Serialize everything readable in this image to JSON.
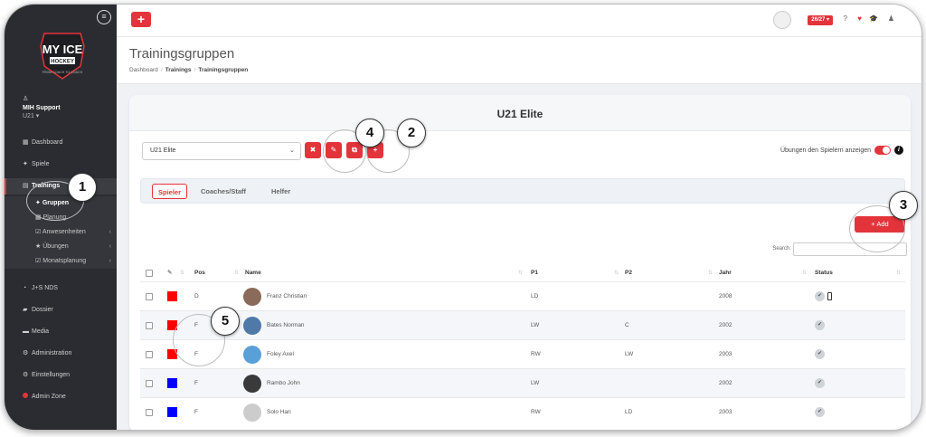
{
  "sidebar": {
    "logo_text": "MY ICE",
    "logo_sub": "HOCKEY",
    "logo_tag": "FROM COACH TO COACH",
    "user_name": "MIH Support",
    "user_role": "U21 ▾",
    "items": [
      {
        "label": "Dashboard",
        "icon": "▦"
      },
      {
        "label": "Spiele",
        "icon": "✦"
      },
      {
        "label": "Trainings",
        "icon": "▤"
      },
      {
        "label": "J+S NDS",
        "icon": "◔"
      },
      {
        "label": "Dossier",
        "icon": "▰"
      },
      {
        "label": "Media",
        "icon": "▬"
      },
      {
        "label": "Administration",
        "icon": "⚙"
      },
      {
        "label": "Einstellungen",
        "icon": "⚙"
      },
      {
        "label": "Admin Zone",
        "icon": "●"
      }
    ],
    "subitems": [
      {
        "label": "Gruppen",
        "icon": "✦"
      },
      {
        "label": "Planung",
        "icon": "▦"
      },
      {
        "label": "Anwesenheiten",
        "icon": "☑"
      },
      {
        "label": "Übungen",
        "icon": "★"
      },
      {
        "label": "Monatsplanung",
        "icon": "☑"
      }
    ]
  },
  "topbar": {
    "add_label": "+",
    "season": "26/27 ▾",
    "icons": [
      "?",
      "♥",
      "🎓",
      "♟"
    ]
  },
  "header": {
    "title": "Trainingsgruppen",
    "breadcrumb": [
      "Dashboard",
      "Trainings",
      "Trainingsgruppen"
    ]
  },
  "card": {
    "title": "U21 Elite",
    "select_value": "U21 Elite",
    "toggle_label": "Übungen den Spielern anzeigen",
    "tabs": [
      "Spieler",
      "Coaches/Staff",
      "Helfer"
    ],
    "add_label": "+ Add",
    "search_label": "Search:"
  },
  "table": {
    "columns": [
      "Pos",
      "Name",
      "P1",
      "P2",
      "Jahr",
      "Status"
    ],
    "rows": [
      {
        "color": "#ff0000",
        "pos": "D",
        "name": "Franz Christian",
        "p1": "LD",
        "p2": "",
        "jahr": "2008",
        "avatar": "#8a6a5a"
      },
      {
        "color": "#ff0000",
        "pos": "F",
        "name": "Bates Norman",
        "p1": "LW",
        "p2": "C",
        "jahr": "2002",
        "avatar": "#4f7aa8"
      },
      {
        "color": "#ff0000",
        "pos": "F",
        "name": "Foley Axel",
        "p1": "RW",
        "p2": "LW",
        "jahr": "2003",
        "avatar": "#5aa0d8"
      },
      {
        "color": "#0000ff",
        "pos": "F",
        "name": "Rambo John",
        "p1": "LW",
        "p2": "",
        "jahr": "2002",
        "avatar": "#3a3a3a"
      },
      {
        "color": "#0000ff",
        "pos": "F",
        "name": "Solo Han",
        "p1": "RW",
        "p2": "LD",
        "jahr": "2003",
        "avatar": "#cccccc"
      }
    ]
  },
  "callouts": [
    "1",
    "2",
    "3",
    "4",
    "5"
  ]
}
